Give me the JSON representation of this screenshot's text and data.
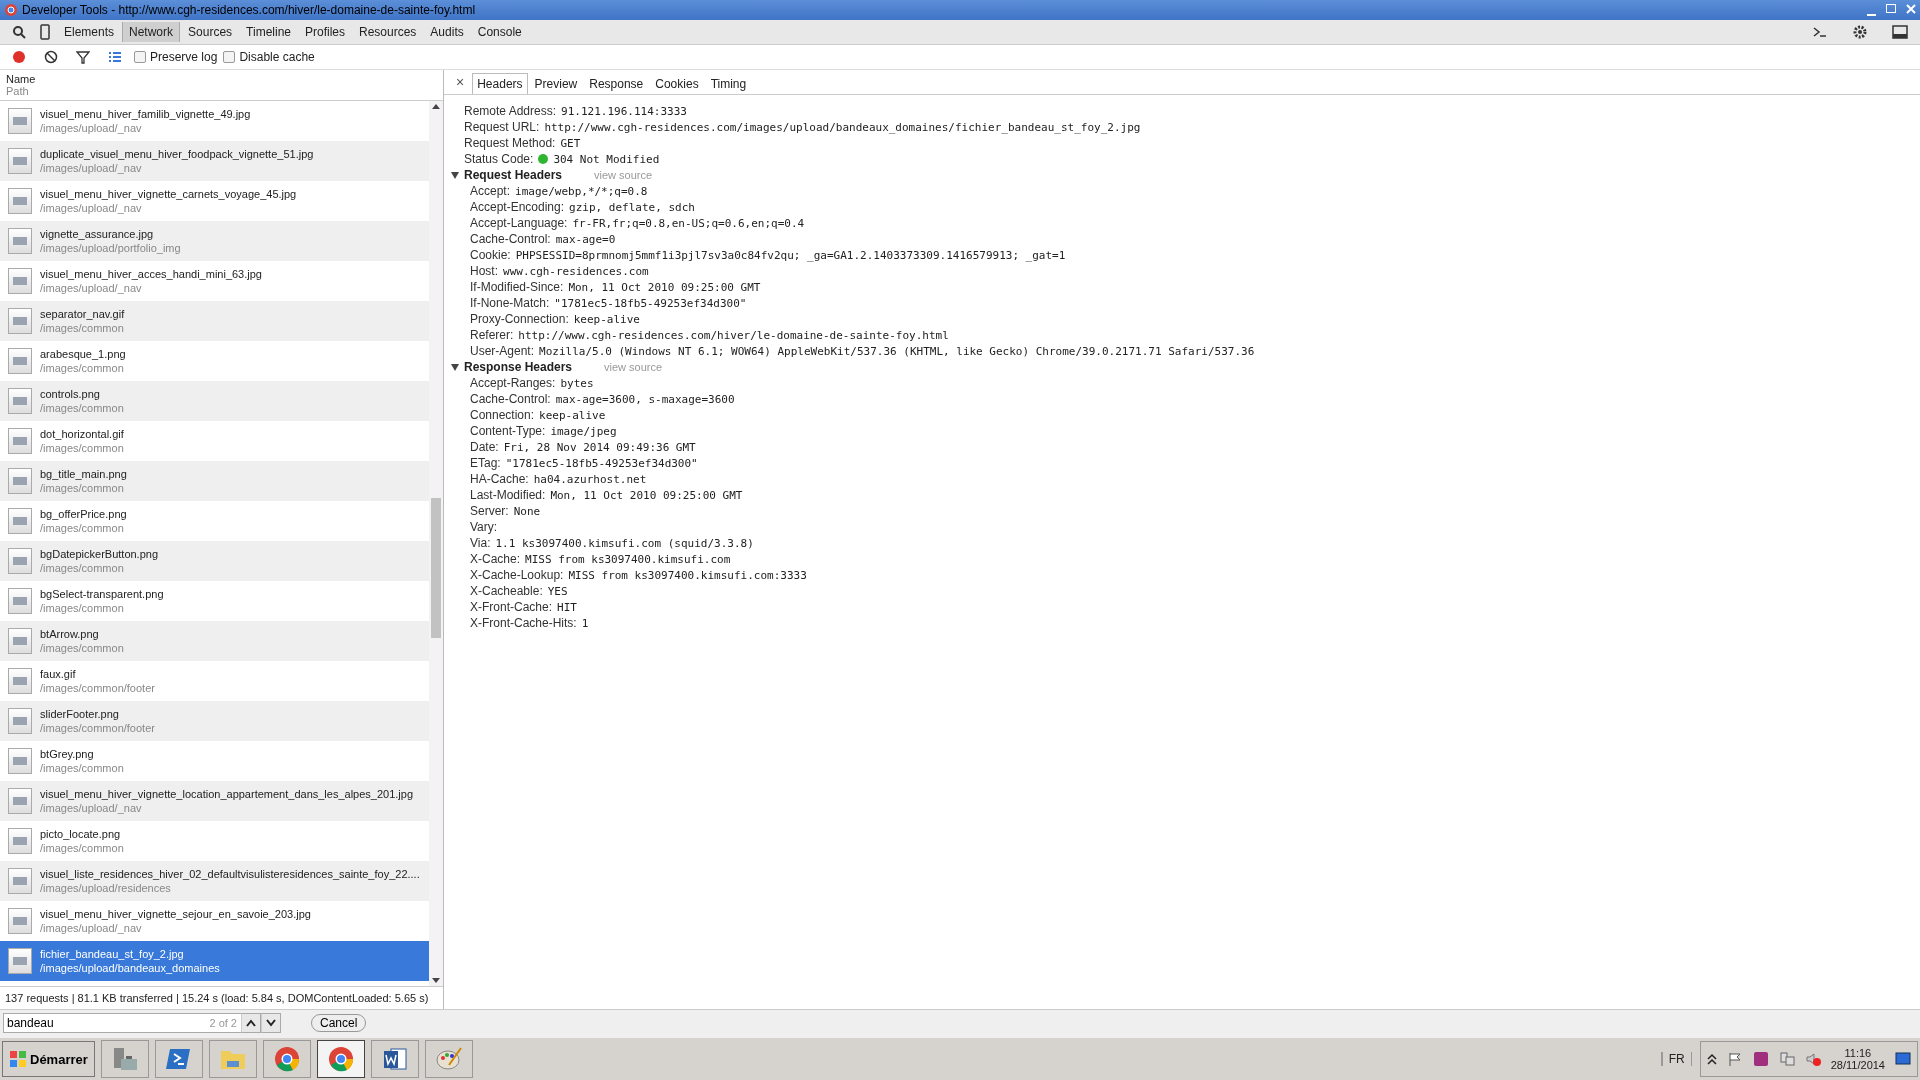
{
  "window": {
    "title": "Developer Tools - http://www.cgh-residences.com/hiver/le-domaine-de-sainte-foy.html"
  },
  "panels": [
    {
      "label": "Elements",
      "selected": false
    },
    {
      "label": "Network",
      "selected": true
    },
    {
      "label": "Sources",
      "selected": false
    },
    {
      "label": "Timeline",
      "selected": false
    },
    {
      "label": "Profiles",
      "selected": false
    },
    {
      "label": "Resources",
      "selected": false
    },
    {
      "label": "Audits",
      "selected": false
    },
    {
      "label": "Console",
      "selected": false
    }
  ],
  "options": [
    {
      "label": "Preserve log",
      "checked": false
    },
    {
      "label": "Disable cache",
      "checked": false
    }
  ],
  "requests": {
    "name_heading": "Name",
    "path_heading": "Path",
    "items": [
      {
        "name": "visuel_menu_hiver_familib_vignette_49.jpg",
        "path": "/images/upload/_nav",
        "selected": false
      },
      {
        "name": "duplicate_visuel_menu_hiver_foodpack_vignette_51.jpg",
        "path": "/images/upload/_nav",
        "selected": false
      },
      {
        "name": "visuel_menu_hiver_vignette_carnets_voyage_45.jpg",
        "path": "/images/upload/_nav",
        "selected": false
      },
      {
        "name": "vignette_assurance.jpg",
        "path": "/images/upload/portfolio_img",
        "selected": false
      },
      {
        "name": "visuel_menu_hiver_acces_handi_mini_63.jpg",
        "path": "/images/upload/_nav",
        "selected": false
      },
      {
        "name": "separator_nav.gif",
        "path": "/images/common",
        "selected": false
      },
      {
        "name": "arabesque_1.png",
        "path": "/images/common",
        "selected": false
      },
      {
        "name": "controls.png",
        "path": "/images/common",
        "selected": false
      },
      {
        "name": "dot_horizontal.gif",
        "path": "/images/common",
        "selected": false
      },
      {
        "name": "bg_title_main.png",
        "path": "/images/common",
        "selected": false
      },
      {
        "name": "bg_offerPrice.png",
        "path": "/images/common",
        "selected": false
      },
      {
        "name": "bgDatepickerButton.png",
        "path": "/images/common",
        "selected": false
      },
      {
        "name": "bgSelect-transparent.png",
        "path": "/images/common",
        "selected": false
      },
      {
        "name": "btArrow.png",
        "path": "/images/common",
        "selected": false
      },
      {
        "name": "faux.gif",
        "path": "/images/common/footer",
        "selected": false
      },
      {
        "name": "sliderFooter.png",
        "path": "/images/common/footer",
        "selected": false
      },
      {
        "name": "btGrey.png",
        "path": "/images/common",
        "selected": false
      },
      {
        "name": "visuel_menu_hiver_vignette_location_appartement_dans_les_alpes_201.jpg",
        "path": "/images/upload/_nav",
        "selected": false
      },
      {
        "name": "picto_locate.png",
        "path": "/images/common",
        "selected": false
      },
      {
        "name": "visuel_liste_residences_hiver_02_defaultvisulisteresidences_sainte_foy_22....",
        "path": "/images/upload/residences",
        "selected": false
      },
      {
        "name": "visuel_menu_hiver_vignette_sejour_en_savoie_203.jpg",
        "path": "/images/upload/_nav",
        "selected": false
      },
      {
        "name": "fichier_bandeau_st_foy_2.jpg",
        "path": "/images/upload/bandeaux_domaines",
        "selected": true
      }
    ]
  },
  "summary": "137 requests | 81.1 KB transferred | 15.24 s (load: 5.84 s, DOMContentLoaded: 5.65 s)",
  "find": {
    "value": "bandeau",
    "count": "2 of 2",
    "cancel": "Cancel"
  },
  "detail": {
    "close": "×",
    "tabs": [
      {
        "label": "Headers",
        "selected": true
      },
      {
        "label": "Preview",
        "selected": false
      },
      {
        "label": "Response",
        "selected": false
      },
      {
        "label": "Cookies",
        "selected": false
      },
      {
        "label": "Timing",
        "selected": false
      }
    ],
    "general": [
      {
        "key": "Remote Address:",
        "value": "91.121.196.114:3333",
        "kind": "plain"
      },
      {
        "key": "Request URL:",
        "value": "http://www.cgh-residences.com/images/upload/bandeaux_domaines/fichier_bandeau_st_foy_2.jpg",
        "kind": "plain"
      },
      {
        "key": "Request Method:",
        "value": "GET",
        "kind": "plain"
      },
      {
        "key": "Status Code:",
        "value": "304 Not Modified",
        "kind": "status"
      }
    ],
    "sections": [
      {
        "title": "Request Headers",
        "link": "view source",
        "expanded": true,
        "headers": [
          {
            "key": "Accept:",
            "value": "image/webp,*/*;q=0.8"
          },
          {
            "key": "Accept-Encoding:",
            "value": "gzip, deflate, sdch"
          },
          {
            "key": "Accept-Language:",
            "value": "fr-FR,fr;q=0.8,en-US;q=0.6,en;q=0.4"
          },
          {
            "key": "Cache-Control:",
            "value": "max-age=0"
          },
          {
            "key": "Cookie:",
            "value": "PHPSESSID=8prmnomj5mmf1i3pjl7sv3a0c84fv2qu; _ga=GA1.2.1403373309.1416579913; _gat=1"
          },
          {
            "key": "Host:",
            "value": "www.cgh-residences.com"
          },
          {
            "key": "If-Modified-Since:",
            "value": "Mon, 11 Oct 2010 09:25:00 GMT"
          },
          {
            "key": "If-None-Match:",
            "value": "\"1781ec5-18fb5-49253ef34d300\""
          },
          {
            "key": "Proxy-Connection:",
            "value": "keep-alive"
          },
          {
            "key": "Referer:",
            "value": "http://www.cgh-residences.com/hiver/le-domaine-de-sainte-foy.html"
          },
          {
            "key": "User-Agent:",
            "value": "Mozilla/5.0 (Windows NT 6.1; WOW64) AppleWebKit/537.36 (KHTML, like Gecko) Chrome/39.0.2171.71 Safari/537.36"
          }
        ]
      },
      {
        "title": "Response Headers",
        "link": "view source",
        "expanded": true,
        "headers": [
          {
            "key": "Accept-Ranges:",
            "value": "bytes"
          },
          {
            "key": "Cache-Control:",
            "value": "max-age=3600, s-maxage=3600"
          },
          {
            "key": "Connection:",
            "value": "keep-alive"
          },
          {
            "key": "Content-Type:",
            "value": "image/jpeg"
          },
          {
            "key": "Date:",
            "value": "Fri, 28 Nov 2014 09:49:36 GMT"
          },
          {
            "key": "ETag:",
            "value": "\"1781ec5-18fb5-49253ef34d300\""
          },
          {
            "key": "HA-Cache:",
            "value": "ha04.azurhost.net"
          },
          {
            "key": "Last-Modified:",
            "value": "Mon, 11 Oct 2010 09:25:00 GMT"
          },
          {
            "key": "Server:",
            "value": "None"
          },
          {
            "key": "Vary:"
          },
          {
            "key": "Via:",
            "value": "1.1 ks3097400.kimsufi.com (squid/3.3.8)"
          },
          {
            "key": "X-Cache:",
            "value": "MISS from ks3097400.kimsufi.com"
          },
          {
            "key": "X-Cache-Lookup:",
            "value": "MISS from ks3097400.kimsufi.com:3333"
          },
          {
            "key": "X-Cacheable:",
            "value": "YES"
          },
          {
            "key": "X-Front-Cache:",
            "value": "HIT"
          },
          {
            "key": "X-Front-Cache-Hits:",
            "value": "1"
          }
        ]
      }
    ]
  },
  "taskbar": {
    "start": "Démarrer",
    "apps": [
      {
        "kind": "server",
        "selected": false
      },
      {
        "kind": "shell",
        "selected": false
      },
      {
        "kind": "folder",
        "selected": false
      },
      {
        "kind": "browser",
        "selected": false
      },
      {
        "kind": "browser",
        "selected": true
      },
      {
        "kind": "word",
        "selected": false
      },
      {
        "kind": "paint",
        "selected": false
      }
    ],
    "language": "FR",
    "time": "11:16",
    "date": "28/11/2014"
  }
}
